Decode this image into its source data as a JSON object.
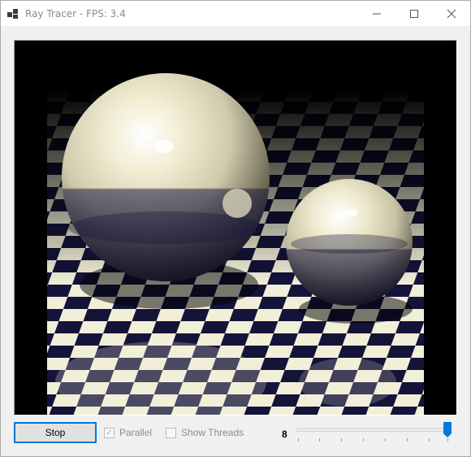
{
  "window": {
    "title": "Ray Tracer - FPS: 3.4",
    "controls": {
      "minimize_icon": "minimize-icon",
      "maximize_icon": "maximize-icon",
      "close_icon": "close-icon"
    }
  },
  "render": {
    "description_icon": "ray-traced-scene"
  },
  "controls": {
    "stop_label": "Stop",
    "parallel_label": "Parallel",
    "parallel_checked": true,
    "parallel_enabled": false,
    "show_threads_label": "Show Threads",
    "show_threads_checked": false,
    "show_threads_enabled": false,
    "thread_count": "8",
    "slider_fraction": 1.0
  },
  "colors": {
    "accent": "#0078d7",
    "sphere": "#e8e3c8",
    "floor_light": "#f2efd8",
    "floor_dark": "#14133a"
  }
}
